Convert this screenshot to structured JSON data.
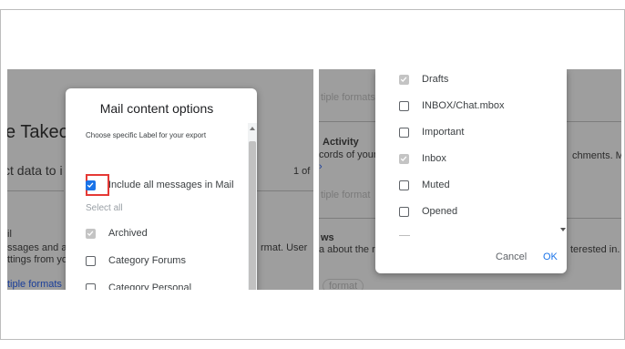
{
  "left": {
    "background": {
      "page_title_fragment": "e Takeou",
      "select_data_fragment": "ct data to i",
      "pagination": "1 of",
      "section_letter": "il",
      "desc_line1": "ssages and a",
      "desc_line2": "ttings from yo",
      "format_fragment": "rmat. User",
      "link_fragment": "tiple formats"
    },
    "dialog": {
      "title": "Mail content options",
      "subtitle": "Choose specific Label for your export",
      "include_all_label": "Include all messages in Mail",
      "select_all_label": "Select all",
      "labels": [
        {
          "name": "Archived",
          "state": "checked-disabled"
        },
        {
          "name": "Category Forums",
          "state": "unchecked"
        },
        {
          "name": "Category Personal",
          "state": "unchecked"
        }
      ]
    }
  },
  "right": {
    "background": {
      "link_fragment1": "tiple formats",
      "activity_heading": "Activity",
      "records_fragment": "cords of your",
      "link_fragment2": "tiple format",
      "attachments_fragment": "chments. Mo",
      "ws_fragment": "ws",
      "about_fragment": "a about the r",
      "interested_fragment": "terested in.",
      "format_chip": "format"
    },
    "dialog": {
      "labels": [
        {
          "name": "Drafts",
          "state": "checked-disabled"
        },
        {
          "name": "INBOX/Chat.mbox",
          "state": "unchecked"
        },
        {
          "name": "Important",
          "state": "unchecked"
        },
        {
          "name": "Inbox",
          "state": "checked-disabled"
        },
        {
          "name": "Muted",
          "state": "unchecked"
        },
        {
          "name": "Opened",
          "state": "unchecked"
        }
      ],
      "cancel_label": "Cancel",
      "ok_label": "OK"
    }
  },
  "colors": {
    "accent": "#1a73e8",
    "highlight": "#e53935",
    "overlay": "#9e9e9e"
  }
}
